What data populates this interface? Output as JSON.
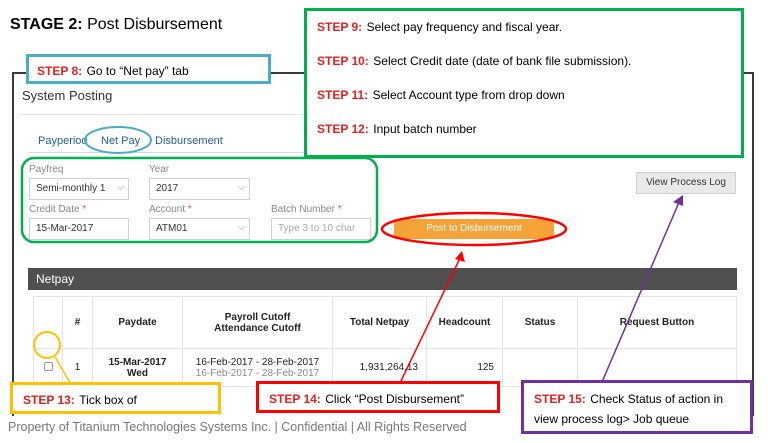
{
  "stage": {
    "label": "STAGE 2:",
    "title": "Post Disbursement"
  },
  "screen": {
    "title": "System Posting",
    "tabs": [
      "Payperiod",
      "Net Pay",
      "Disbursement"
    ],
    "form": {
      "payfreq": {
        "label": "Payfreq",
        "value": "Semi-monthly 1"
      },
      "year": {
        "label": "Year",
        "value": "2017"
      },
      "credit_date": {
        "label": "Credit Date",
        "value": "15-Mar-2017"
      },
      "account": {
        "label": "Account",
        "value": "ATM01"
      },
      "batch": {
        "label": "Batch Number",
        "placeholder": "Type 3 to 10 char"
      },
      "required_mark": "*"
    },
    "buttons": {
      "view_log": "View Process Log",
      "post": "Post to Disbursement"
    },
    "section_title": "Netpay",
    "table": {
      "headers": {
        "num": "#",
        "paydate": "Paydate",
        "cutoff_1": "Payroll Cutoff",
        "cutoff_2": "Attendance Cutoff",
        "net": "Total Netpay",
        "headcount": "Headcount",
        "status": "Status",
        "request": "Request Button"
      },
      "row": {
        "num": "1",
        "paydate": "15-Mar-2017",
        "day": "Wed",
        "payroll_cutoff": "16-Feb-2017 - 28-Feb-2017",
        "attendance_cutoff": "16-Feb-2017 - 28-Feb-2017",
        "net": "1,931,264.13",
        "headcount": "125",
        "status": "",
        "request": ""
      }
    }
  },
  "steps": {
    "s8": {
      "label": "STEP 8:",
      "text": "Go to “Net pay” tab"
    },
    "s9": {
      "label": "STEP 9:",
      "text": "Select pay frequency and fiscal year."
    },
    "s10": {
      "label": "STEP 10:",
      "text": "Select Credit date (date of bank file submission)."
    },
    "s11": {
      "label": "STEP 11:",
      "text": "Select Account type from drop down"
    },
    "s12": {
      "label": "STEP 12:",
      "text": "Input batch number"
    },
    "s13": {
      "label": "STEP 13:",
      "text": "Tick box of"
    },
    "s14": {
      "label": "STEP 14:",
      "text": "Click “Post Disbursement”"
    },
    "s15": {
      "label": "STEP 15:",
      "text": "Check Status of action in",
      "text2": "view process log> Job queue"
    }
  },
  "footer": "Property of Titanium Technologies Systems Inc. | Confidential | All Rights Reserved",
  "colors": {
    "blue": "#4bacc6",
    "green": "#00b050",
    "red": "#ff0000",
    "orange": "#ffc000",
    "purple": "#7030a0",
    "button_orange": "#f5a339"
  }
}
